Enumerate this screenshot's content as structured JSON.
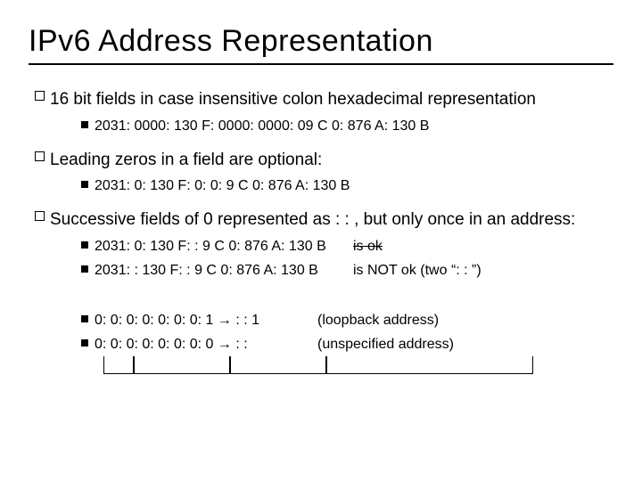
{
  "title": "IPv6 Address Representation",
  "p1": "16 bit fields in case insensitive colon hexadecimal representation",
  "p1_sub1": "2031: 0000: 130 F: 0000: 0000: 09 C 0: 876 A: 130 B",
  "p2": "Leading zeros in a field are optional:",
  "p2_sub1": "2031: 0: 130 F: 0: 0: 9 C 0: 876 A: 130 B",
  "p3": "Successive fields of 0 represented as : : , but only once in an address:",
  "p3_sub1_a": "2031: 0: 130 F: : 9 C 0: 876 A: 130 B",
  "p3_sub1_b": "is ok",
  "p3_sub2_a": "2031: : 130 F: : 9 C 0: 876 A: 130 B",
  "p3_sub2_b": "is NOT ok (two “: : ”)",
  "p3_sub3_a": "0: 0: 0: 0: 0: 0: 0: 1 → : : 1",
  "p3_sub3_b": "(loopback address)",
  "p3_sub4_a": "0: 0: 0: 0: 0: 0: 0: 0 → : :",
  "p3_sub4_b": "(unspecified address)"
}
